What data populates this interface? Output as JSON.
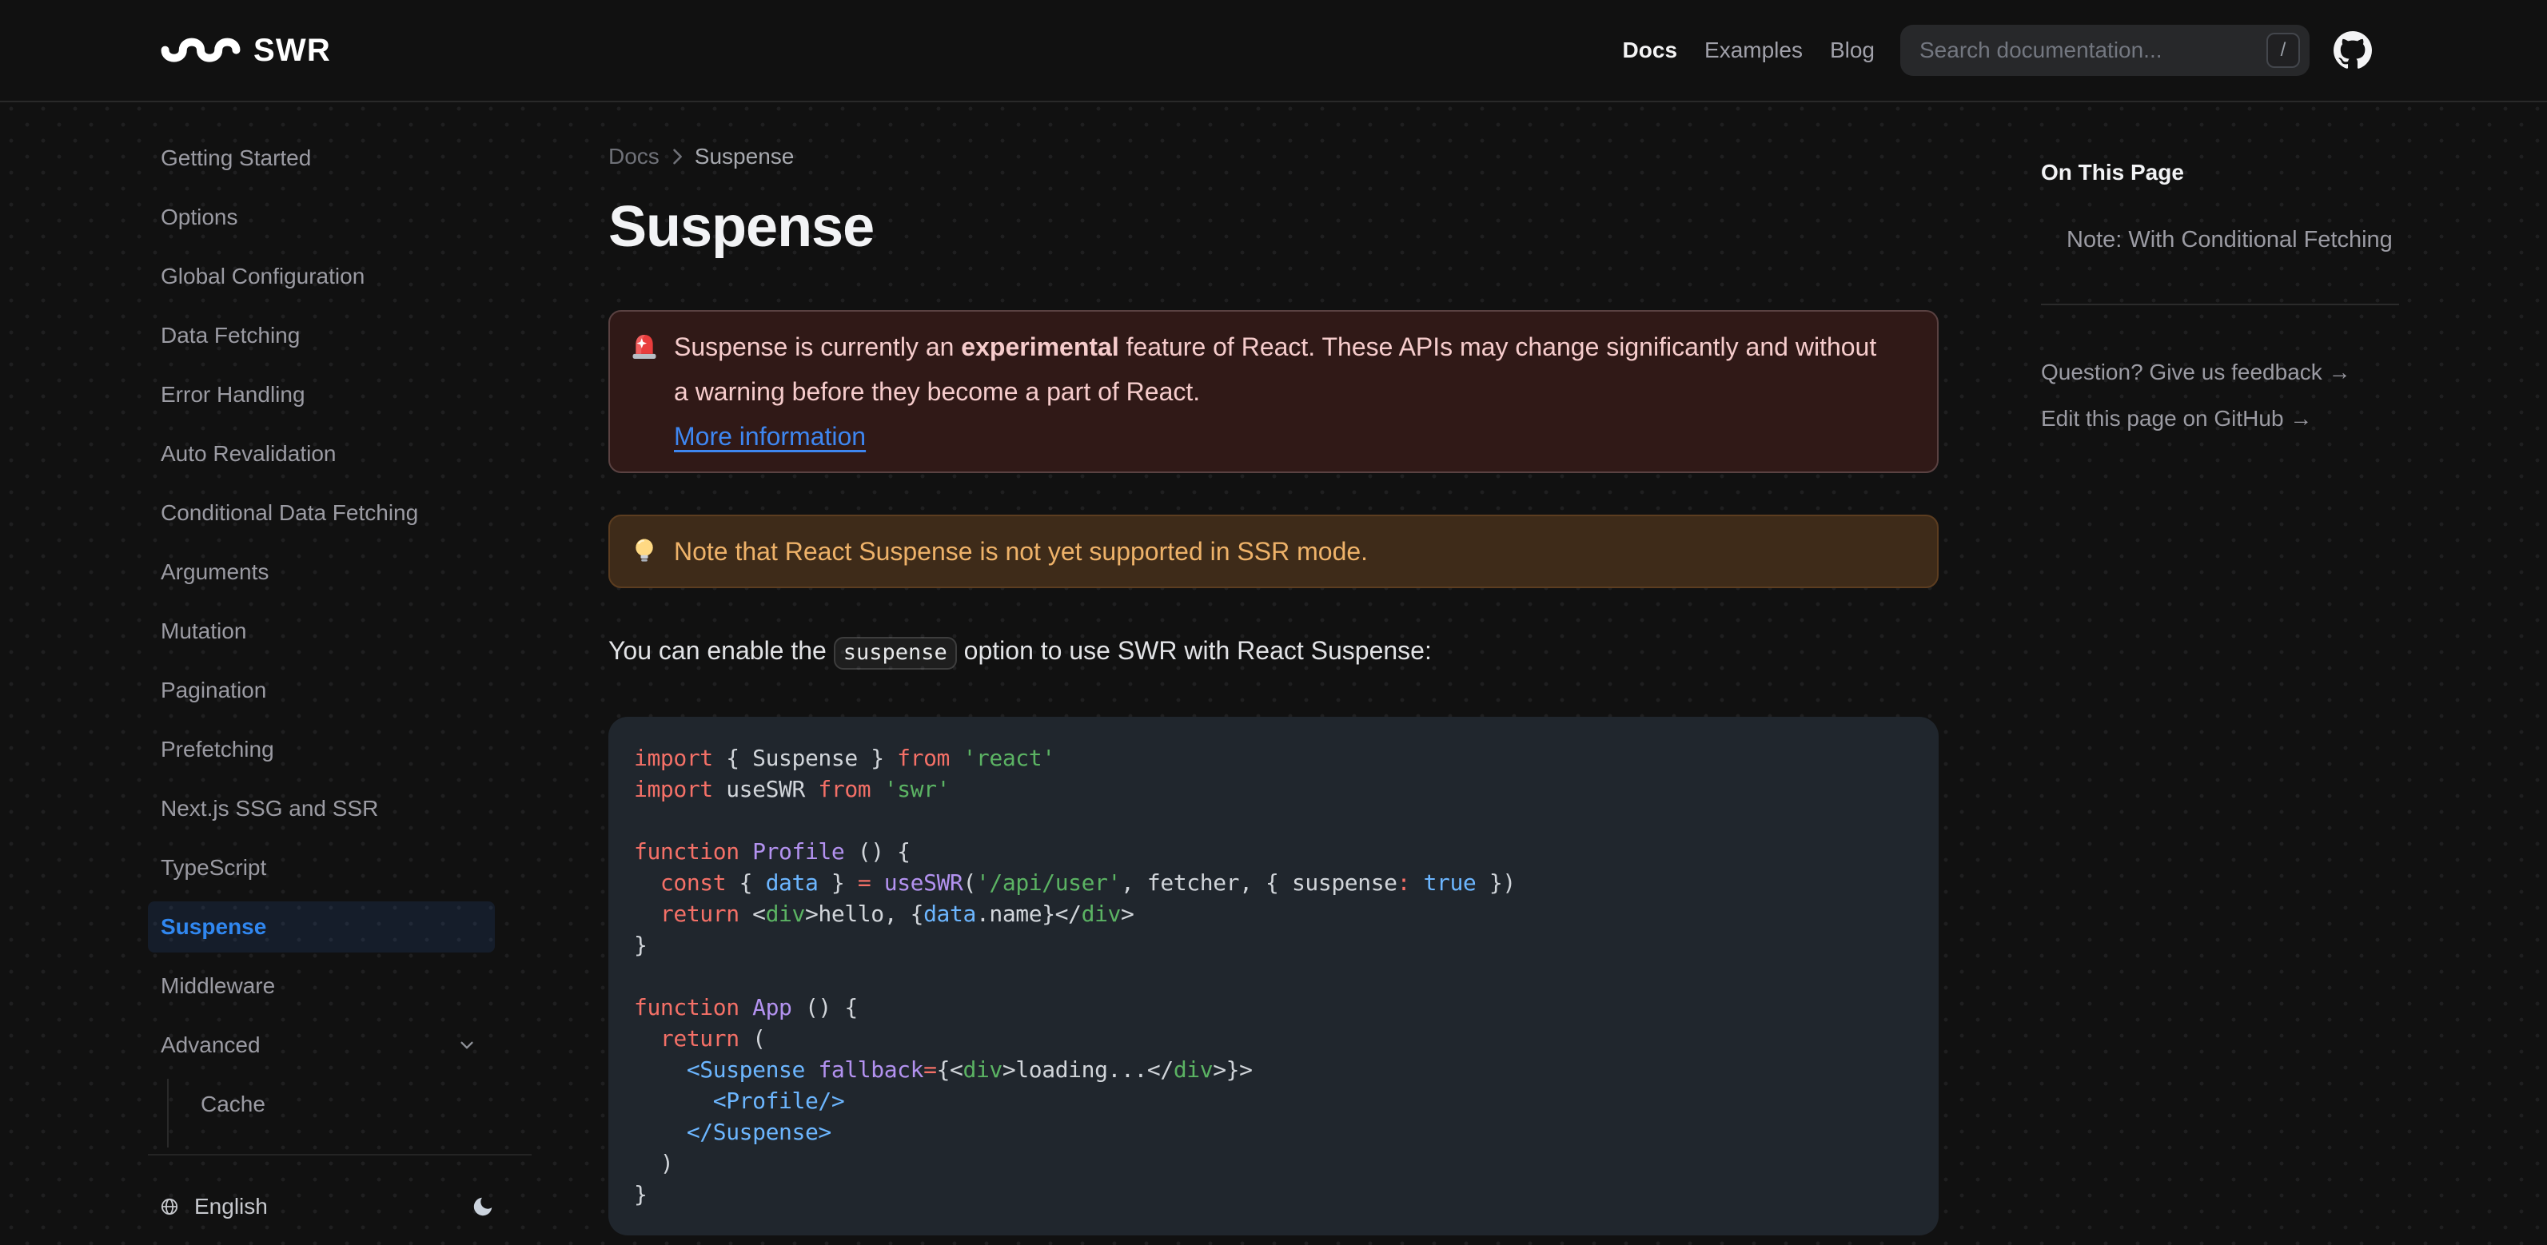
{
  "header": {
    "logo_text": "SWR",
    "nav": [
      {
        "label": "Docs",
        "active": true
      },
      {
        "label": "Examples",
        "active": false
      },
      {
        "label": "Blog",
        "active": false
      }
    ],
    "search": {
      "placeholder": "Search documentation...",
      "shortcut": "/"
    }
  },
  "sidebar": {
    "items": [
      {
        "label": "Getting Started"
      },
      {
        "label": "Options"
      },
      {
        "label": "Global Configuration"
      },
      {
        "label": "Data Fetching"
      },
      {
        "label": "Error Handling"
      },
      {
        "label": "Auto Revalidation"
      },
      {
        "label": "Conditional Data Fetching"
      },
      {
        "label": "Arguments"
      },
      {
        "label": "Mutation"
      },
      {
        "label": "Pagination"
      },
      {
        "label": "Prefetching"
      },
      {
        "label": "Next.js SSG and SSR"
      },
      {
        "label": "TypeScript"
      },
      {
        "label": "Suspense",
        "active": true
      },
      {
        "label": "Middleware"
      },
      {
        "label": "Advanced",
        "expandable": true
      }
    ],
    "children": [
      {
        "label": "Cache"
      }
    ],
    "footer": {
      "language": "English"
    }
  },
  "breadcrumb": {
    "root": "Docs",
    "current": "Suspense"
  },
  "page": {
    "title": "Suspense",
    "callout_error": {
      "icon": "siren-emoji",
      "text_before": "Suspense is currently an ",
      "text_bold": "experimental",
      "text_after": " feature of React. These APIs may change significantly and without a warning before they become a part of React.",
      "link_label": "More information"
    },
    "callout_warning": {
      "icon": "bulb-emoji",
      "text": "Note that React Suspense is not yet supported in SSR mode."
    },
    "paragraph": {
      "before": "You can enable the ",
      "code": "suspense",
      "after": " option to use SWR with React Suspense:"
    },
    "code_block": {
      "language": "jsx",
      "lines": [
        [
          [
            "k",
            "import"
          ],
          [
            "t",
            " { Suspense } "
          ],
          [
            "k",
            "from"
          ],
          [
            "t",
            " "
          ],
          [
            "s",
            "'react'"
          ]
        ],
        [
          [
            "k",
            "import"
          ],
          [
            "t",
            " useSWR "
          ],
          [
            "k",
            "from"
          ],
          [
            "t",
            " "
          ],
          [
            "s",
            "'swr'"
          ]
        ],
        [],
        [
          [
            "k",
            "function"
          ],
          [
            "t",
            " "
          ],
          [
            "f",
            "Profile"
          ],
          [
            "t",
            " () {"
          ]
        ],
        [
          [
            "t",
            "  "
          ],
          [
            "k",
            "const"
          ],
          [
            "t",
            " { "
          ],
          [
            "c",
            "data"
          ],
          [
            "t",
            " } "
          ],
          [
            "k",
            "="
          ],
          [
            "t",
            " "
          ],
          [
            "f",
            "useSWR"
          ],
          [
            "t",
            "("
          ],
          [
            "s",
            "'/api/user'"
          ],
          [
            "t",
            ", fetcher, { suspense"
          ],
          [
            "k",
            ":"
          ],
          [
            "t",
            " "
          ],
          [
            "c",
            "true"
          ],
          [
            "t",
            " })"
          ]
        ],
        [
          [
            "t",
            "  "
          ],
          [
            "k",
            "return"
          ],
          [
            "t",
            " <"
          ],
          [
            "s",
            "div"
          ],
          [
            "t",
            ">hello, {"
          ],
          [
            "c",
            "data"
          ],
          [
            "t",
            ".name}</"
          ],
          [
            "s",
            "div"
          ],
          [
            "t",
            ">"
          ]
        ],
        [
          [
            "t",
            "}"
          ]
        ],
        [],
        [
          [
            "k",
            "function"
          ],
          [
            "t",
            " "
          ],
          [
            "f",
            "App"
          ],
          [
            "t",
            " () {"
          ]
        ],
        [
          [
            "t",
            "  "
          ],
          [
            "k",
            "return"
          ],
          [
            "t",
            " ("
          ]
        ],
        [
          [
            "t",
            "    "
          ],
          [
            "c",
            "<Suspense"
          ],
          [
            "t",
            " "
          ],
          [
            "f",
            "fallback"
          ],
          [
            "k",
            "="
          ],
          [
            "t",
            "{<"
          ],
          [
            "s",
            "div"
          ],
          [
            "t",
            ">loading...</"
          ],
          [
            "s",
            "div"
          ],
          [
            "t",
            ">}>"
          ]
        ],
        [
          [
            "t",
            "      "
          ],
          [
            "c",
            "<Profile/>"
          ]
        ],
        [
          [
            "t",
            "    "
          ],
          [
            "c",
            "</Suspense>"
          ]
        ],
        [
          [
            "t",
            "  )"
          ]
        ],
        [
          [
            "t",
            "}"
          ]
        ]
      ]
    }
  },
  "toc": {
    "title": "On This Page",
    "items": [
      "Note: With Conditional Fetching"
    ],
    "links": [
      "Question? Give us feedback →",
      "Edit this page on GitHub →"
    ]
  },
  "colors": {
    "background": "#111111",
    "accent_blue": "#3b82f6",
    "error_bg": "#301917",
    "error_text": "#f6cccc",
    "warning_bg": "#3e2b19",
    "warning_text": "#eeb269",
    "code_bg": "#20262d",
    "token_keyword": "#f47067",
    "token_text": "#d1d5da",
    "token_function": "#b392f0",
    "token_constant": "#6cb6ff",
    "token_string": "#5bb363"
  }
}
